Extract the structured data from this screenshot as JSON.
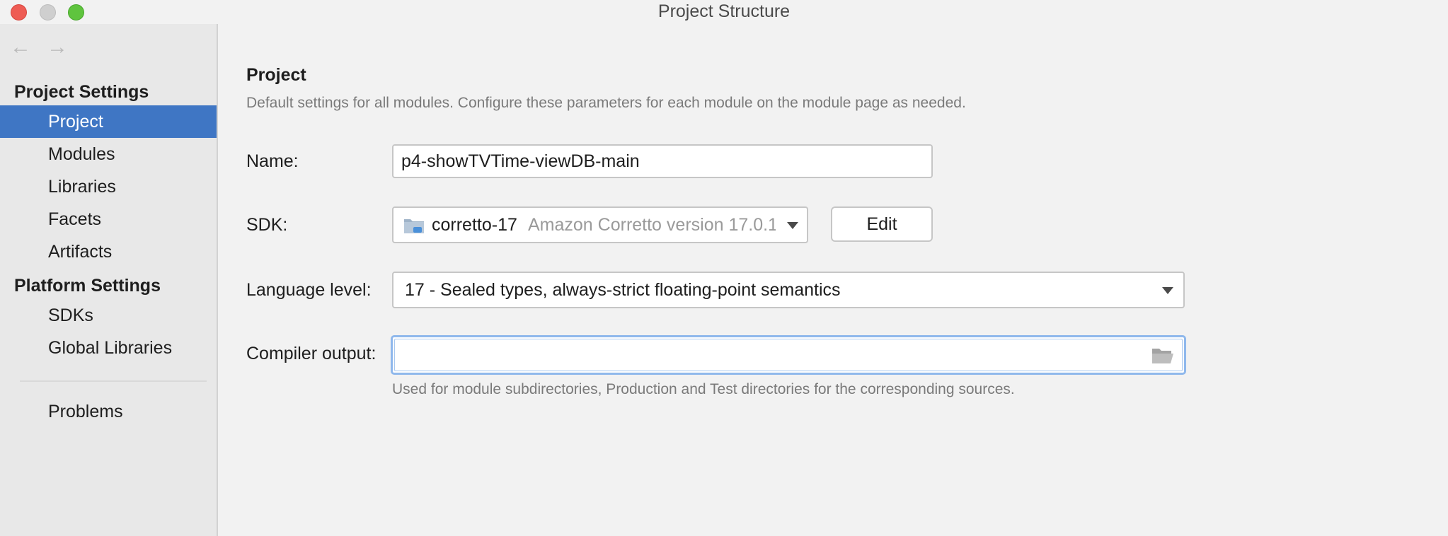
{
  "window": {
    "title": "Project Structure",
    "controls": [
      "close",
      "minimize",
      "maximize"
    ]
  },
  "nav": {
    "back_icon": "←",
    "forward_icon": "→"
  },
  "sidebar": {
    "project_settings_header": "Project Settings",
    "project_settings_items": [
      {
        "label": "Project",
        "selected": true
      },
      {
        "label": "Modules",
        "selected": false
      },
      {
        "label": "Libraries",
        "selected": false
      },
      {
        "label": "Facets",
        "selected": false
      },
      {
        "label": "Artifacts",
        "selected": false
      }
    ],
    "platform_settings_header": "Platform Settings",
    "platform_settings_items": [
      {
        "label": "SDKs"
      },
      {
        "label": "Global Libraries"
      }
    ],
    "problems_label": "Problems"
  },
  "main": {
    "title": "Project",
    "description": "Default settings for all modules. Configure these parameters for each module on the module page as needed.",
    "name_label": "Name:",
    "name_value": "p4-showTVTime-viewDB-main",
    "sdk_label": "SDK:",
    "sdk_name": "corretto-17",
    "sdk_version": "Amazon Corretto version 17.0.1",
    "edit_button": "Edit",
    "language_level_label": "Language level:",
    "language_level_value": "17 - Sealed types, always-strict floating-point semantics",
    "compiler_output_label": "Compiler output:",
    "compiler_output_value": "",
    "compiler_output_hint": "Used for module subdirectories, Production and Test directories for the corresponding sources."
  },
  "colors": {
    "selection": "#3f76c4",
    "focus_ring": "#8fb8ec",
    "close": "#ee5c54",
    "maximize": "#5fc43e"
  }
}
